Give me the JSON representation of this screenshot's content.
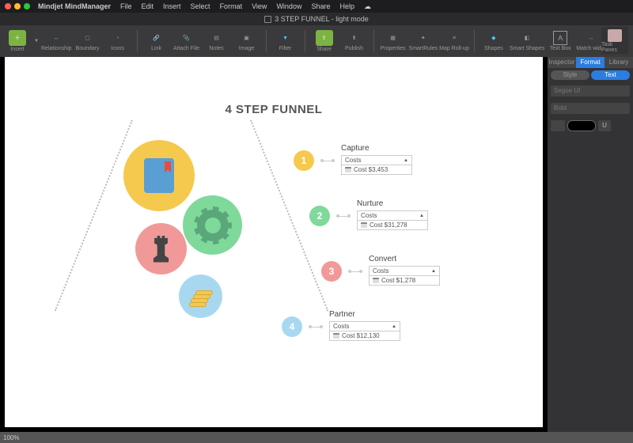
{
  "menubar": {
    "app": "Mindjet MindManager",
    "items": [
      "File",
      "Edit",
      "Insert",
      "Select",
      "Format",
      "View",
      "Window",
      "Share",
      "Help"
    ]
  },
  "title": "3 STEP FUNNEL - light mode",
  "toolbar": {
    "insert": "Insert",
    "relationship": "Relationship",
    "boundary": "Boundary",
    "icons": "Icons",
    "link": "Link",
    "attach": "Attach File",
    "notes": "Notes",
    "image": "Image",
    "filter": "Filter",
    "share": "Share",
    "publish": "Publish",
    "properties": "Properties",
    "smartrules": "SmartRules",
    "maprollup": "Map Roll-up",
    "shapes": "Shapes",
    "smartshapes": "Smart Shapes",
    "textbox": "Text Box",
    "matchwidth": "Match width",
    "taskpanes": "Task Panes"
  },
  "canvas": {
    "title": "4 STEP FUNNEL"
  },
  "steps": [
    {
      "n": "1",
      "label": "Capture",
      "costs_hdr": "Costs",
      "row": "Cost $3,453"
    },
    {
      "n": "2",
      "label": "Nurture",
      "costs_hdr": "Costs",
      "row": "Cost $31,278"
    },
    {
      "n": "3",
      "label": "Convert",
      "costs_hdr": "Costs",
      "row": "Cost $1,278"
    },
    {
      "n": "4",
      "label": "Partner",
      "costs_hdr": "Costs",
      "row": "Cost $12,130"
    }
  ],
  "panel": {
    "tabs": [
      "Inspector",
      "Format",
      "Library"
    ],
    "active_tab": "Format",
    "subtabs": [
      "Style",
      "Text"
    ],
    "active_sub": "Text",
    "font": "Segoe UI",
    "weight": "Bold",
    "underline": "U"
  },
  "status": {
    "zoom": "100%"
  }
}
